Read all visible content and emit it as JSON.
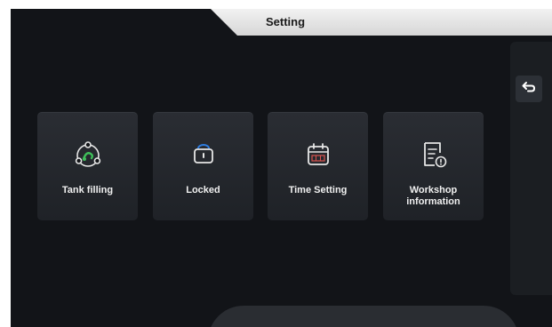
{
  "header": {
    "title": "Setting"
  },
  "nav": {
    "back_icon": "back-arrow-icon"
  },
  "tiles": [
    {
      "label": "Tank filling",
      "icon": "tank-filling-icon"
    },
    {
      "label": "Locked",
      "icon": "lock-icon"
    },
    {
      "label": "Time Setting",
      "icon": "calendar-icon"
    },
    {
      "label": "Workshop information",
      "icon": "document-info-icon"
    }
  ],
  "colors": {
    "background": "#121418",
    "tile": "#24272c",
    "accent_green": "#3fbf5a",
    "accent_blue": "#2f7de1",
    "header_bg": "#e4e4e4"
  }
}
